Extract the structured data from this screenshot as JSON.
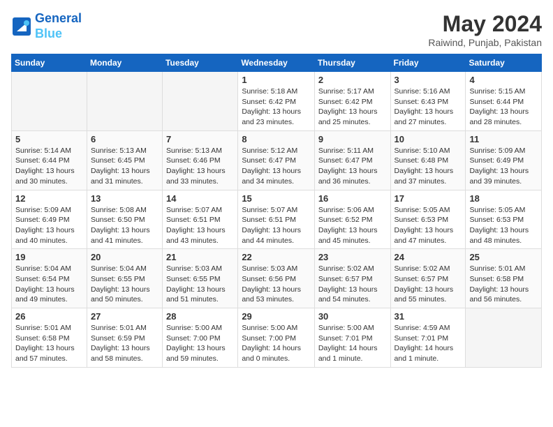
{
  "header": {
    "logo_line1": "General",
    "logo_line2": "Blue",
    "month_year": "May 2024",
    "location": "Raiwind, Punjab, Pakistan"
  },
  "weekdays": [
    "Sunday",
    "Monday",
    "Tuesday",
    "Wednesday",
    "Thursday",
    "Friday",
    "Saturday"
  ],
  "weeks": [
    [
      {
        "day": "",
        "info": ""
      },
      {
        "day": "",
        "info": ""
      },
      {
        "day": "",
        "info": ""
      },
      {
        "day": "1",
        "info": "Sunrise: 5:18 AM\nSunset: 6:42 PM\nDaylight: 13 hours\nand 23 minutes."
      },
      {
        "day": "2",
        "info": "Sunrise: 5:17 AM\nSunset: 6:42 PM\nDaylight: 13 hours\nand 25 minutes."
      },
      {
        "day": "3",
        "info": "Sunrise: 5:16 AM\nSunset: 6:43 PM\nDaylight: 13 hours\nand 27 minutes."
      },
      {
        "day": "4",
        "info": "Sunrise: 5:15 AM\nSunset: 6:44 PM\nDaylight: 13 hours\nand 28 minutes."
      }
    ],
    [
      {
        "day": "5",
        "info": "Sunrise: 5:14 AM\nSunset: 6:44 PM\nDaylight: 13 hours\nand 30 minutes."
      },
      {
        "day": "6",
        "info": "Sunrise: 5:13 AM\nSunset: 6:45 PM\nDaylight: 13 hours\nand 31 minutes."
      },
      {
        "day": "7",
        "info": "Sunrise: 5:13 AM\nSunset: 6:46 PM\nDaylight: 13 hours\nand 33 minutes."
      },
      {
        "day": "8",
        "info": "Sunrise: 5:12 AM\nSunset: 6:47 PM\nDaylight: 13 hours\nand 34 minutes."
      },
      {
        "day": "9",
        "info": "Sunrise: 5:11 AM\nSunset: 6:47 PM\nDaylight: 13 hours\nand 36 minutes."
      },
      {
        "day": "10",
        "info": "Sunrise: 5:10 AM\nSunset: 6:48 PM\nDaylight: 13 hours\nand 37 minutes."
      },
      {
        "day": "11",
        "info": "Sunrise: 5:09 AM\nSunset: 6:49 PM\nDaylight: 13 hours\nand 39 minutes."
      }
    ],
    [
      {
        "day": "12",
        "info": "Sunrise: 5:09 AM\nSunset: 6:49 PM\nDaylight: 13 hours\nand 40 minutes."
      },
      {
        "day": "13",
        "info": "Sunrise: 5:08 AM\nSunset: 6:50 PM\nDaylight: 13 hours\nand 41 minutes."
      },
      {
        "day": "14",
        "info": "Sunrise: 5:07 AM\nSunset: 6:51 PM\nDaylight: 13 hours\nand 43 minutes."
      },
      {
        "day": "15",
        "info": "Sunrise: 5:07 AM\nSunset: 6:51 PM\nDaylight: 13 hours\nand 44 minutes."
      },
      {
        "day": "16",
        "info": "Sunrise: 5:06 AM\nSunset: 6:52 PM\nDaylight: 13 hours\nand 45 minutes."
      },
      {
        "day": "17",
        "info": "Sunrise: 5:05 AM\nSunset: 6:53 PM\nDaylight: 13 hours\nand 47 minutes."
      },
      {
        "day": "18",
        "info": "Sunrise: 5:05 AM\nSunset: 6:53 PM\nDaylight: 13 hours\nand 48 minutes."
      }
    ],
    [
      {
        "day": "19",
        "info": "Sunrise: 5:04 AM\nSunset: 6:54 PM\nDaylight: 13 hours\nand 49 minutes."
      },
      {
        "day": "20",
        "info": "Sunrise: 5:04 AM\nSunset: 6:55 PM\nDaylight: 13 hours\nand 50 minutes."
      },
      {
        "day": "21",
        "info": "Sunrise: 5:03 AM\nSunset: 6:55 PM\nDaylight: 13 hours\nand 51 minutes."
      },
      {
        "day": "22",
        "info": "Sunrise: 5:03 AM\nSunset: 6:56 PM\nDaylight: 13 hours\nand 53 minutes."
      },
      {
        "day": "23",
        "info": "Sunrise: 5:02 AM\nSunset: 6:57 PM\nDaylight: 13 hours\nand 54 minutes."
      },
      {
        "day": "24",
        "info": "Sunrise: 5:02 AM\nSunset: 6:57 PM\nDaylight: 13 hours\nand 55 minutes."
      },
      {
        "day": "25",
        "info": "Sunrise: 5:01 AM\nSunset: 6:58 PM\nDaylight: 13 hours\nand 56 minutes."
      }
    ],
    [
      {
        "day": "26",
        "info": "Sunrise: 5:01 AM\nSunset: 6:58 PM\nDaylight: 13 hours\nand 57 minutes."
      },
      {
        "day": "27",
        "info": "Sunrise: 5:01 AM\nSunset: 6:59 PM\nDaylight: 13 hours\nand 58 minutes."
      },
      {
        "day": "28",
        "info": "Sunrise: 5:00 AM\nSunset: 7:00 PM\nDaylight: 13 hours\nand 59 minutes."
      },
      {
        "day": "29",
        "info": "Sunrise: 5:00 AM\nSunset: 7:00 PM\nDaylight: 14 hours\nand 0 minutes."
      },
      {
        "day": "30",
        "info": "Sunrise: 5:00 AM\nSunset: 7:01 PM\nDaylight: 14 hours\nand 1 minute."
      },
      {
        "day": "31",
        "info": "Sunrise: 4:59 AM\nSunset: 7:01 PM\nDaylight: 14 hours\nand 1 minute."
      },
      {
        "day": "",
        "info": ""
      }
    ]
  ]
}
